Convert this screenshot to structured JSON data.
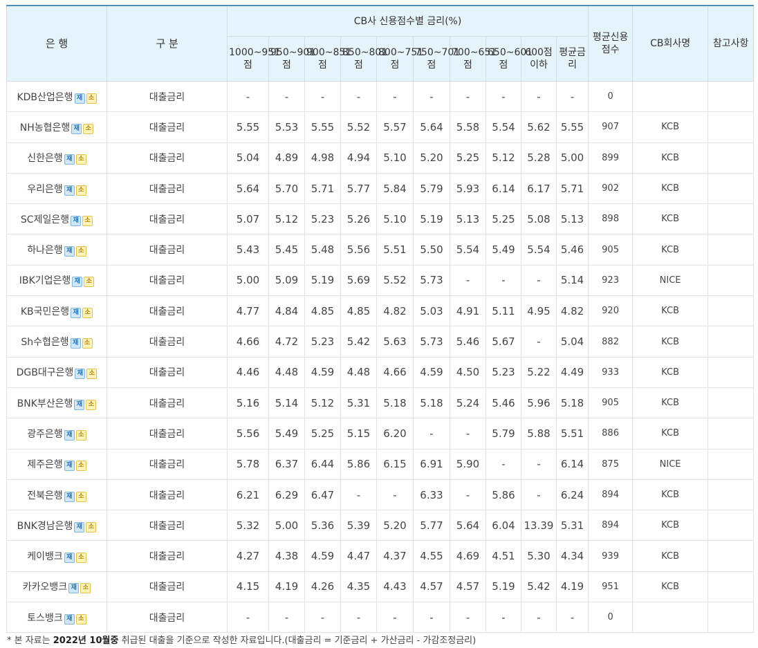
{
  "headers": {
    "bank": "은 행",
    "category": "구 분",
    "cb_group": "CB사 신용점수별 금리(%)",
    "avg_score": "평균신용점수",
    "cb_company": "CB회사명",
    "note": "참고사항",
    "ranges": [
      "1000~951점",
      "950~901점",
      "900~851점",
      "850~801점",
      "800~751점",
      "750~701점",
      "700~651점",
      "650~601점",
      "600점 이하",
      "평균금리"
    ]
  },
  "badges": {
    "b1": "재",
    "b2": "소"
  },
  "rows": [
    {
      "bank": "KDB산업은행",
      "cat": "대출금리",
      "v": [
        "-",
        "-",
        "-",
        "-",
        "-",
        "-",
        "-",
        "-",
        "-",
        "-"
      ],
      "score": "0",
      "cb": ""
    },
    {
      "bank": "NH농협은행",
      "cat": "대출금리",
      "v": [
        "5.55",
        "5.53",
        "5.55",
        "5.52",
        "5.57",
        "5.64",
        "5.58",
        "5.54",
        "5.62",
        "5.55"
      ],
      "score": "907",
      "cb": "KCB"
    },
    {
      "bank": "신한은행",
      "cat": "대출금리",
      "v": [
        "5.04",
        "4.89",
        "4.98",
        "4.94",
        "5.10",
        "5.20",
        "5.25",
        "5.12",
        "5.28",
        "5.00"
      ],
      "score": "899",
      "cb": "KCB"
    },
    {
      "bank": "우리은행",
      "cat": "대출금리",
      "v": [
        "5.64",
        "5.70",
        "5.71",
        "5.77",
        "5.84",
        "5.79",
        "5.93",
        "6.14",
        "6.17",
        "5.71"
      ],
      "score": "902",
      "cb": "KCB"
    },
    {
      "bank": "SC제일은행",
      "cat": "대출금리",
      "v": [
        "5.07",
        "5.12",
        "5.23",
        "5.26",
        "5.10",
        "5.19",
        "5.13",
        "5.25",
        "5.08",
        "5.13"
      ],
      "score": "898",
      "cb": "KCB"
    },
    {
      "bank": "하나은행",
      "cat": "대출금리",
      "v": [
        "5.43",
        "5.45",
        "5.48",
        "5.56",
        "5.51",
        "5.50",
        "5.54",
        "5.49",
        "5.54",
        "5.46"
      ],
      "score": "905",
      "cb": "KCB"
    },
    {
      "bank": "IBK기업은행",
      "cat": "대출금리",
      "v": [
        "5.00",
        "5.09",
        "5.19",
        "5.69",
        "5.52",
        "5.73",
        "-",
        "-",
        "-",
        "5.14"
      ],
      "score": "923",
      "cb": "NICE"
    },
    {
      "bank": "KB국민은행",
      "cat": "대출금리",
      "v": [
        "4.77",
        "4.84",
        "4.85",
        "4.85",
        "4.82",
        "5.03",
        "4.91",
        "5.11",
        "4.95",
        "4.82"
      ],
      "score": "920",
      "cb": "KCB"
    },
    {
      "bank": "Sh수협은행",
      "cat": "대출금리",
      "v": [
        "4.66",
        "4.72",
        "5.23",
        "5.42",
        "5.63",
        "5.73",
        "5.46",
        "5.67",
        "-",
        "5.04"
      ],
      "score": "882",
      "cb": "KCB"
    },
    {
      "bank": "DGB대구은행",
      "cat": "대출금리",
      "v": [
        "4.46",
        "4.48",
        "4.59",
        "4.48",
        "4.66",
        "4.59",
        "4.50",
        "5.23",
        "5.22",
        "4.49"
      ],
      "score": "933",
      "cb": "KCB"
    },
    {
      "bank": "BNK부산은행",
      "cat": "대출금리",
      "v": [
        "5.16",
        "5.14",
        "5.12",
        "5.31",
        "5.18",
        "5.18",
        "5.24",
        "5.46",
        "5.96",
        "5.18"
      ],
      "score": "905",
      "cb": "KCB"
    },
    {
      "bank": "광주은행",
      "cat": "대출금리",
      "v": [
        "5.56",
        "5.49",
        "5.25",
        "5.15",
        "6.20",
        "-",
        "-",
        "5.79",
        "5.88",
        "5.51"
      ],
      "score": "886",
      "cb": "KCB"
    },
    {
      "bank": "제주은행",
      "cat": "대출금리",
      "v": [
        "5.78",
        "6.37",
        "6.44",
        "5.86",
        "6.15",
        "6.91",
        "5.90",
        "-",
        "-",
        "6.14"
      ],
      "score": "875",
      "cb": "NICE"
    },
    {
      "bank": "전북은행",
      "cat": "대출금리",
      "v": [
        "6.21",
        "6.29",
        "6.47",
        "-",
        "-",
        "6.33",
        "-",
        "5.86",
        "-",
        "6.24"
      ],
      "score": "894",
      "cb": "KCB"
    },
    {
      "bank": "BNK경남은행",
      "cat": "대출금리",
      "v": [
        "5.32",
        "5.00",
        "5.36",
        "5.39",
        "5.20",
        "5.77",
        "5.64",
        "6.04",
        "13.39",
        "5.31"
      ],
      "score": "894",
      "cb": "KCB"
    },
    {
      "bank": "케이뱅크",
      "cat": "대출금리",
      "v": [
        "4.27",
        "4.38",
        "4.59",
        "4.47",
        "4.37",
        "4.55",
        "4.69",
        "4.51",
        "5.30",
        "4.34"
      ],
      "score": "939",
      "cb": "KCB"
    },
    {
      "bank": "카카오뱅크",
      "cat": "대출금리",
      "v": [
        "4.15",
        "4.19",
        "4.26",
        "4.35",
        "4.43",
        "4.57",
        "4.57",
        "5.19",
        "5.42",
        "4.19"
      ],
      "score": "951",
      "cb": "KCB"
    },
    {
      "bank": "토스뱅크",
      "cat": "대출금리",
      "v": [
        "-",
        "-",
        "-",
        "-",
        "-",
        "-",
        "-",
        "-",
        "-",
        "-"
      ],
      "score": "0",
      "cb": ""
    }
  ],
  "footnote": {
    "prefix": "* 본 자료는 ",
    "bold1": "2022년 10월중",
    "suffix": " 취급된 대출을 기준으로 작성한 자료입니다.(대출금리 = 기준금리 + 가산금리 - 가감조정금리)"
  }
}
